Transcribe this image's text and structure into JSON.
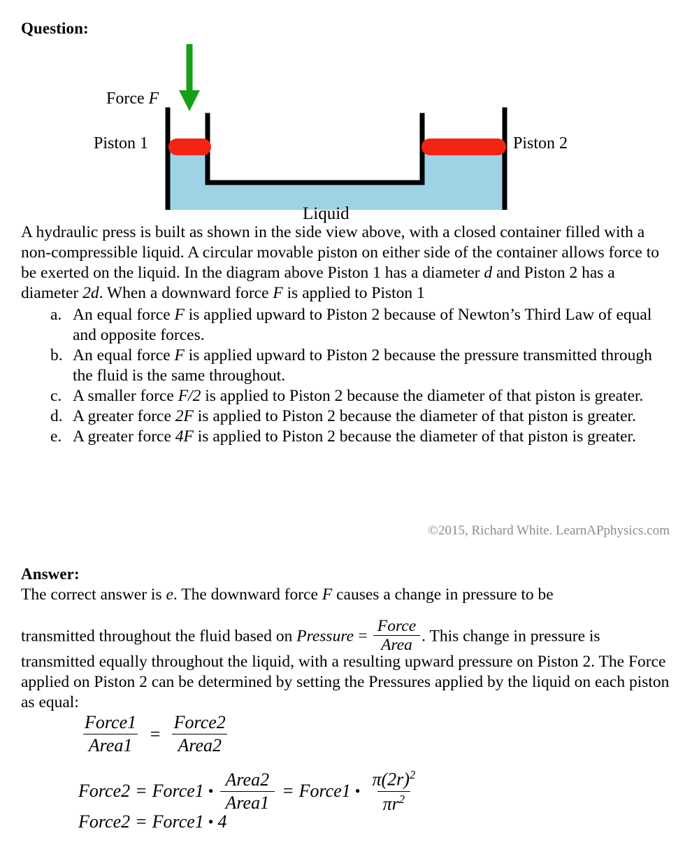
{
  "headings": {
    "question": "Question:",
    "answer": "Answer:"
  },
  "diagram": {
    "force_label_prefix": "Force ",
    "force_label_symbol": "F",
    "piston1_label": "Piston 1",
    "piston2_label": "Piston 2",
    "liquid_label": "Liquid",
    "colors": {
      "liquid": "#9ed3e6",
      "piston": "#f32414",
      "arrow": "#17a017",
      "container": "#000000"
    }
  },
  "intro": {
    "text_part_1": "A hydraulic press is built as shown in the side view above, with a closed container filled with a non-compressible liquid. A circular movable piston on either side of the container allows force to be exerted on the liquid. In the diagram above Piston 1 has a diameter ",
    "sym_d": "d",
    "text_part_2": " and Piston 2 has a diameter ",
    "sym_2d": "2d",
    "text_part_3": ". When a downward force ",
    "sym_F": "F",
    "text_part_4": " is applied to Piston 1"
  },
  "choices": [
    {
      "letter": "a.",
      "pre": "An equal force ",
      "sym": "F",
      "post": " is applied upward to Piston 2 because of Newton’s Third Law of equal and opposite forces."
    },
    {
      "letter": "b.",
      "pre": "An equal force ",
      "sym": "F",
      "post": " is applied upward to Piston 2 because the pressure transmitted through the fluid is the same throughout."
    },
    {
      "letter": "c.",
      "pre": "A smaller force ",
      "sym": "F/2",
      "post": " is applied to Piston 2 because the diameter of that piston is greater."
    },
    {
      "letter": "d.",
      "pre": "A greater force ",
      "sym": "2F",
      "post": " is applied to Piston 2 because the diameter of that piston is greater."
    },
    {
      "letter": "e.",
      "pre": "A greater force ",
      "sym": "4F",
      "post": " is applied to Piston 2 because the diameter of that piston is greater."
    }
  ],
  "copyright": "©2015, Richard White. LearnAPphysics.com",
  "answer": {
    "line1_pre": "The correct answer is ",
    "line1_letter": "e",
    "line1_mid": ". The downward force ",
    "line1_sym": "F",
    "line1_post": " causes a change in pressure to be",
    "line2_pre": "transmitted throughout the fluid based on ",
    "line2_pressure": "Pressure",
    "line2_equals": "=",
    "line2_frac_num": "Force",
    "line2_frac_den": "Area",
    "line2_post": ". This change in pressure is",
    "line3": "transmitted equally throughout the liquid, with a resulting upward pressure on Piston 2. The Force applied on Piston 2 can be determined by setting the Pressures applied by the liquid on each piston as equal:"
  },
  "equations": {
    "eq1": {
      "left_num": "Force1",
      "left_den": "Area1",
      "op": "=",
      "right_num": "Force2",
      "right_den": "Area2"
    },
    "eq2": {
      "lhs": "Force2",
      "op1": "=",
      "term1": "Force1",
      "dot1": "•",
      "frac1_num": "Area2",
      "frac1_den": "Area1",
      "op2": "=",
      "term2": "Force1",
      "dot2": "•",
      "frac2_num_pre": "π(2r)",
      "frac2_num_exp": "2",
      "frac2_den_pre": "πr",
      "frac2_den_exp": "2"
    },
    "eq3": {
      "lhs": "Force2",
      "op": "=",
      "rhs": "Force1",
      "dot": "•",
      "value": "4"
    }
  }
}
